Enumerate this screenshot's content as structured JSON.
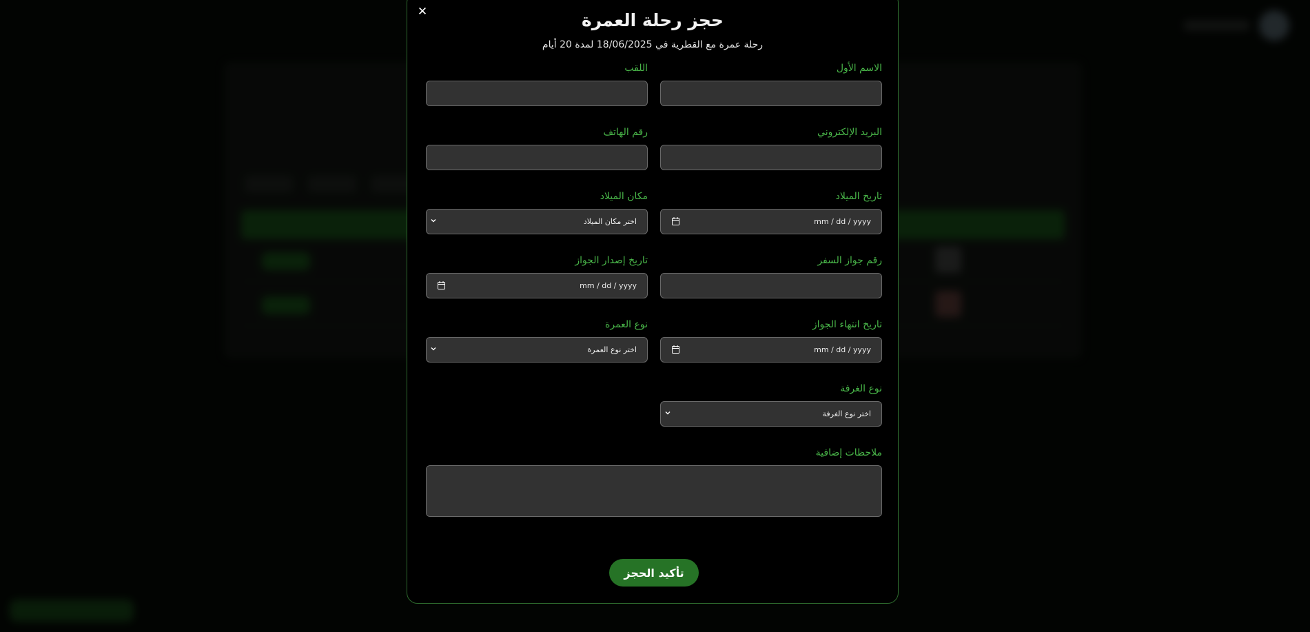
{
  "modal": {
    "close_symbol": "✕",
    "title": "حجز رحلة العمرة",
    "subtitle": "رحلة عمرة مع القطرية في 18/06/2025 لمدة 20 أيام"
  },
  "form": {
    "first_name_label": "الاسم الأول",
    "last_name_label": "اللقب",
    "email_label": "البريد الإلكتروني",
    "phone_label": "رقم الهاتف",
    "birth_date_label": "تاريخ الميلاد",
    "birth_date_value": "mm / dd / yyyy",
    "birth_place_label": "مكان الميلاد",
    "birth_place_value": "اختر مكان الميلاد",
    "passport_number_label": "رقم جواز السفر",
    "passport_issue_label": "تاريخ إصدار الجواز",
    "passport_issue_value": "mm / dd / yyyy",
    "passport_expiry_label": "تاريخ انتهاء الجواز",
    "passport_expiry_value": "mm / dd / yyyy",
    "umrah_type_label": "نوع العمرة",
    "umrah_type_value": "اختر نوع العمرة",
    "room_type_label": "نوع الغرفة",
    "room_type_value": "اختر نوع الغرفة",
    "notes_label": "ملاحظات إضافية",
    "submit_label": "تأكيد الحجز"
  },
  "icons": {
    "calendar": "calendar-icon",
    "chevron": "chevron-down-icon",
    "close": "close-icon"
  },
  "colors": {
    "accent_green": "#49b649",
    "button_green": "#267326",
    "modal_border": "#2d6a2d",
    "field_bg": "#323232"
  }
}
